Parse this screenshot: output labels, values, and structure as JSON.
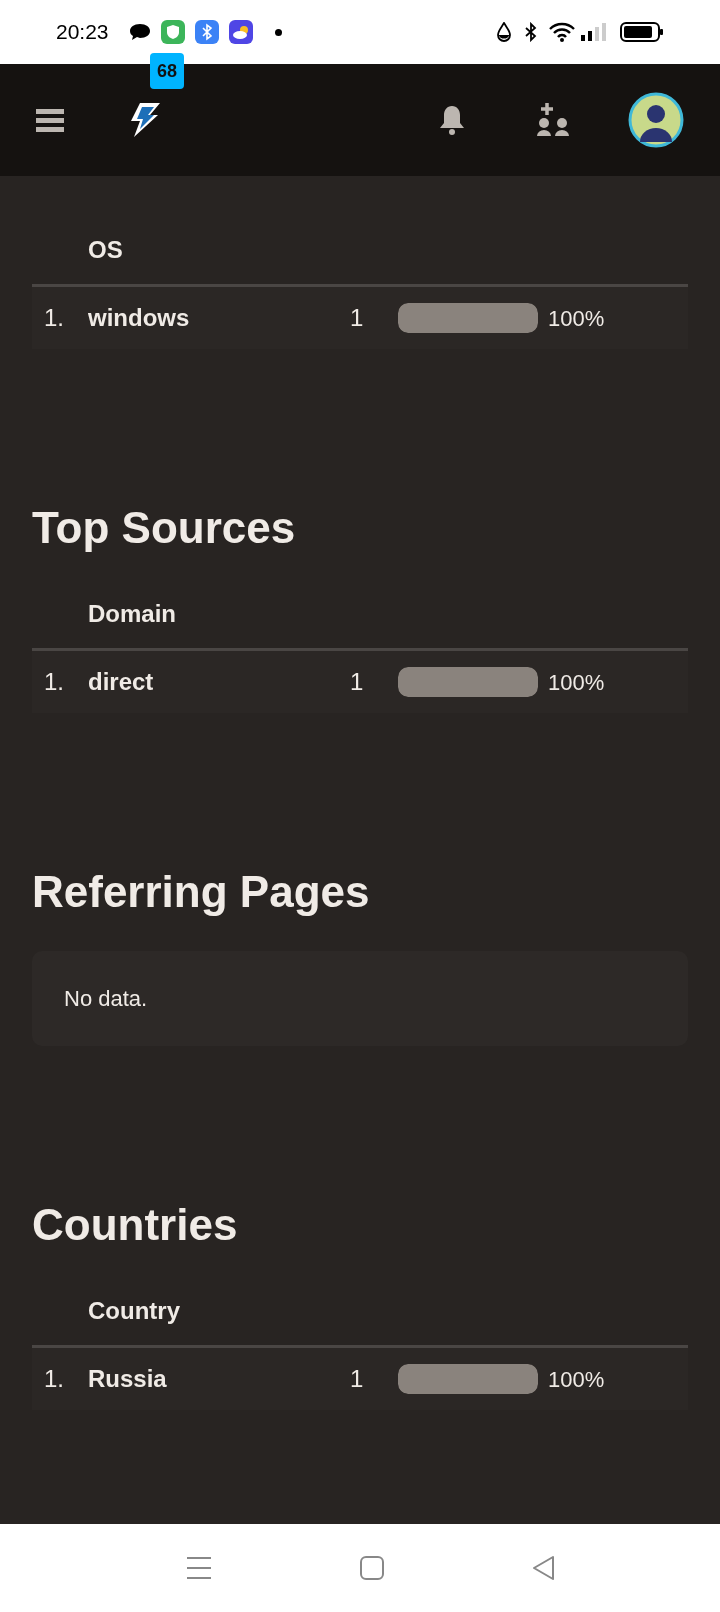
{
  "status_bar": {
    "time": "20:23"
  },
  "header": {
    "badge": "68"
  },
  "sections": [
    {
      "kind": "table",
      "column": "OS",
      "rows": [
        {
          "rank": "1.",
          "name": "windows",
          "count": "1",
          "level": 1,
          "percent": "100%"
        }
      ]
    },
    {
      "kind": "table",
      "title": "Top Sources",
      "column": "Domain",
      "rows": [
        {
          "rank": "1.",
          "name": "direct",
          "count": "1",
          "level": 1,
          "percent": "100%"
        }
      ]
    },
    {
      "kind": "empty",
      "title": "Referring Pages",
      "message": "No data."
    },
    {
      "kind": "table",
      "title": "Countries",
      "column": "Country",
      "rows": [
        {
          "rank": "1.",
          "name": "Russia",
          "count": "1",
          "level": 1,
          "percent": "100%"
        }
      ]
    }
  ]
}
